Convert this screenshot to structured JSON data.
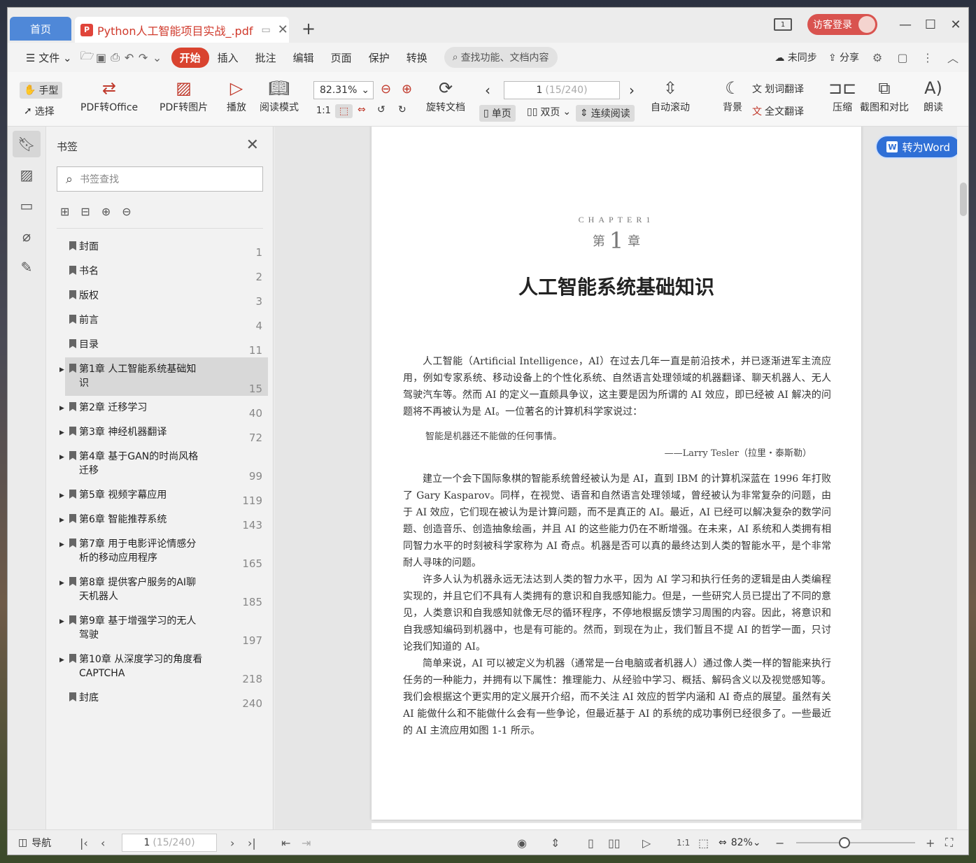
{
  "titlebar": {
    "home_tab": "首页",
    "doc_tab": "Python人工智能项目实战_.pdf",
    "login": "访客登录"
  },
  "menubar": {
    "file": "文件",
    "tabs": [
      "开始",
      "插入",
      "批注",
      "编辑",
      "页面",
      "保护",
      "转换"
    ],
    "search": "查找功能、文档内容",
    "sync": "未同步",
    "share": "分享"
  },
  "ribbon": {
    "hand": "手型",
    "select": "选择",
    "pdf_to_office": "PDF转Office",
    "pdf_to_image": "PDF转图片",
    "play": "播放",
    "read_mode": "阅读模式",
    "zoom": "82.31%",
    "rotate_doc": "旋转文档",
    "page_current": "1",
    "page_total": "(15/240)",
    "single": "单页",
    "double": "双页",
    "continuous": "连续阅读",
    "auto_scroll": "自动滚动",
    "background": "背景",
    "word_translate": "划词翻译",
    "full_translate": "全文翻译",
    "compress": "压缩",
    "screenshot_compare": "截图和对比",
    "read_aloud": "朗读"
  },
  "bookmarks": {
    "title": "书签",
    "search_placeholder": "书签查找",
    "items": [
      {
        "label": "封面",
        "page": "1"
      },
      {
        "label": "书名",
        "page": "2"
      },
      {
        "label": "版权",
        "page": "3"
      },
      {
        "label": "前言",
        "page": "4"
      },
      {
        "label": "目录",
        "page": "11"
      },
      {
        "label": "第1章 人工智能系统基础知识",
        "page": "15"
      },
      {
        "label": "第2章 迁移学习",
        "page": "40"
      },
      {
        "label": "第3章 神经机器翻译",
        "page": "72"
      },
      {
        "label": "第4章 基于GAN的时尚风格迁移",
        "page": "99"
      },
      {
        "label": "第5章 视频字幕应用",
        "page": "119"
      },
      {
        "label": "第6章 智能推荐系统",
        "page": "143"
      },
      {
        "label": "第7章 用于电影评论情感分析的移动应用程序",
        "page": "165"
      },
      {
        "label": "第8章 提供客户服务的AI聊天机器人",
        "page": "185"
      },
      {
        "label": "第9章 基于增强学习的无人驾驶",
        "page": "197"
      },
      {
        "label": "第10章 从深度学习的角度看CAPTCHA",
        "page": "218"
      },
      {
        "label": "封底",
        "page": "240"
      }
    ]
  },
  "document": {
    "to_word": "转为Word",
    "chapter_en": "CHAPTER1",
    "chapter_prefix": "第",
    "chapter_num": "1",
    "chapter_suffix": "章",
    "chapter_title": "人工智能系统基础知识",
    "para1": "人工智能（Artificial Intelligence，AI）在过去几年一直是前沿技术，并已逐渐进军主流应用，例如专家系统、移动设备上的个性化系统、自然语言处理领域的机器翻译、聊天机器人、无人驾驶汽车等。然而 AI 的定义一直颇具争议，这主要是因为所谓的 AI 效应，即已经被 AI 解决的问题将不再被认为是 AI。一位著名的计算机科学家说过：",
    "quote": "智能是机器还不能做的任何事情。",
    "quote_by": "——Larry Tesler（拉里・泰斯勒）",
    "para2": "建立一个会下国际象棋的智能系统曾经被认为是 AI，直到 IBM 的计算机深蓝在 1996 年打败了 Gary Kasparov。同样，在视觉、语音和自然语言处理领域，曾经被认为非常复杂的问题，由于 AI 效应，它们现在被认为是计算问题，而不是真正的 AI。最近，AI 已经可以解决复杂的数学问题、创造音乐、创造抽象绘画，并且 AI 的这些能力仍在不断增强。在未来，AI 系统和人类拥有相同智力水平的时刻被科学家称为 AI 奇点。机器是否可以真的最终达到人类的智能水平，是个非常耐人寻味的问题。",
    "para3": "许多人认为机器永远无法达到人类的智力水平，因为 AI 学习和执行任务的逻辑是由人类编程实现的，并且它们不具有人类拥有的意识和自我感知能力。但是，一些研究人员已提出了不同的意见，人类意识和自我感知就像无尽的循环程序，不停地根据反馈学习周围的内容。因此，将意识和自我感知编码到机器中，也是有可能的。然而，到现在为止，我们暂且不提 AI 的哲学一面，只讨论我们知道的 AI。",
    "para4": "简单来说，AI 可以被定义为机器（通常是一台电脑或者机器人）通过像人类一样的智能来执行任务的一种能力，并拥有以下属性：推理能力、从经验中学习、概括、解码含义以及视觉感知等。我们会根据这个更实用的定义展开介绍，而不关注 AI 效应的哲学内涵和 AI 奇点的展望。虽然有关 AI 能做什么和不能做什么会有一些争论，但最近基于 AI 的系统的成功事例已经很多了。一些最近的 AI 主流应用如图 1-1 所示。"
  },
  "statusbar": {
    "nav": "导航",
    "page_current": "1",
    "page_total": "(15/240)",
    "zoom": "82%"
  }
}
